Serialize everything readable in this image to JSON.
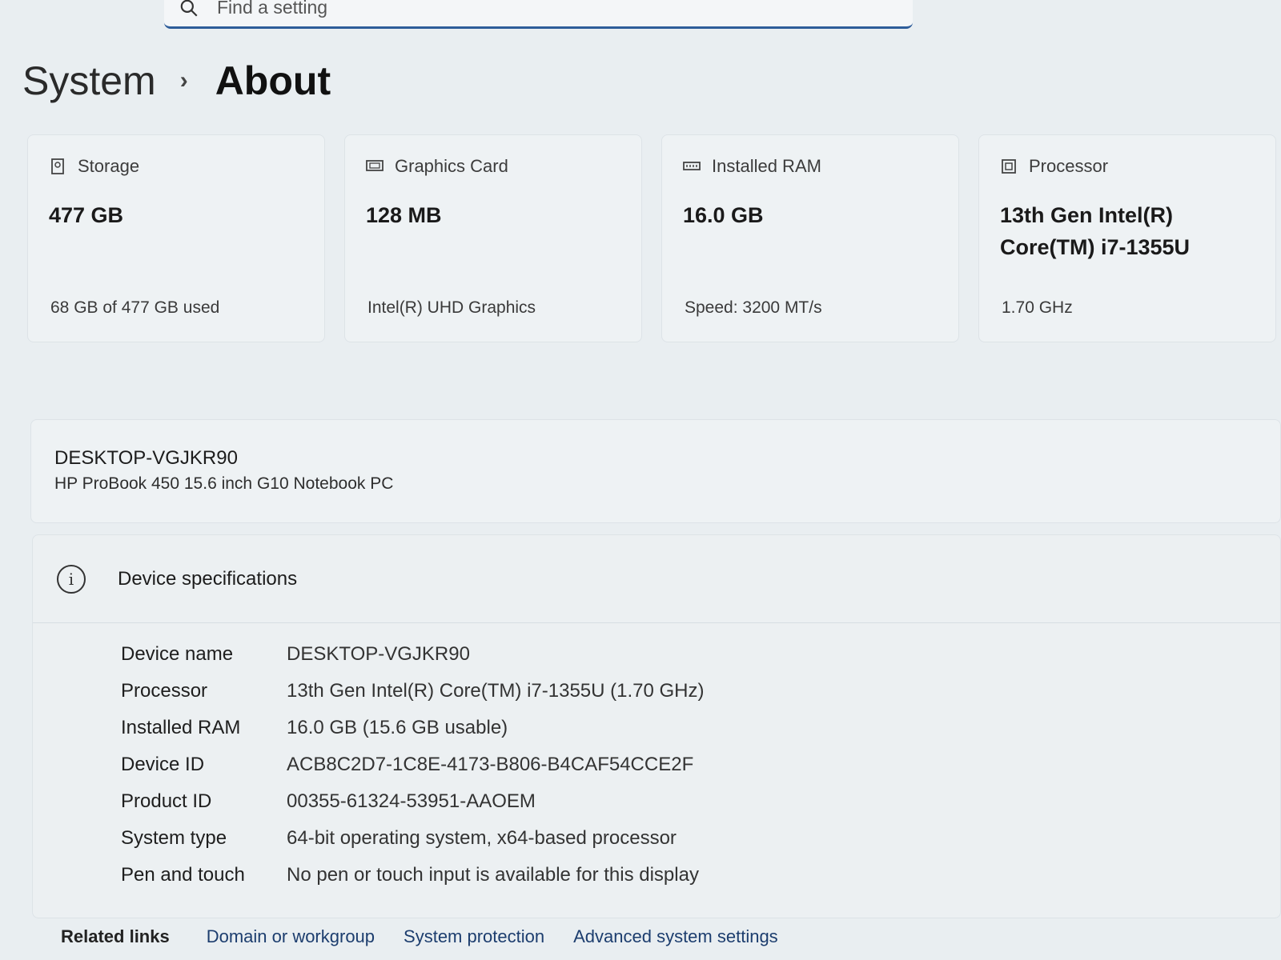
{
  "search": {
    "placeholder": "Find a setting"
  },
  "breadcrumb": {
    "parent": "System",
    "current": "About"
  },
  "cards": [
    {
      "icon": "storage-icon",
      "label": "Storage",
      "value": "477 GB",
      "sub": "68 GB of 477 GB used"
    },
    {
      "icon": "graphics-card-icon",
      "label": "Graphics Card",
      "value": "128 MB",
      "sub": "Intel(R) UHD Graphics"
    },
    {
      "icon": "ram-icon",
      "label": "Installed RAM",
      "value": "16.0 GB",
      "sub": "Speed: 3200 MT/s"
    },
    {
      "icon": "processor-icon",
      "label": "Processor",
      "value": "13th Gen Intel(R) Core(TM) i7-1355U",
      "sub": "1.70 GHz"
    }
  ],
  "device": {
    "name": "DESKTOP-VGJKR90",
    "model": "HP ProBook 450 15.6 inch G10 Notebook PC"
  },
  "specs": {
    "title": "Device specifications",
    "rows": [
      {
        "key": "Device name",
        "value": "DESKTOP-VGJKR90"
      },
      {
        "key": "Processor",
        "value": "13th Gen Intel(R) Core(TM) i7-1355U (1.70 GHz)"
      },
      {
        "key": "Installed RAM",
        "value": "16.0 GB (15.6 GB usable)"
      },
      {
        "key": "Device ID",
        "value": "ACB8C2D7-1C8E-4173-B806-B4CAF54CCE2F"
      },
      {
        "key": "Product ID",
        "value": "00355-61324-53951-AAOEM"
      },
      {
        "key": "System type",
        "value": "64-bit operating system, x64-based processor"
      },
      {
        "key": "Pen and touch",
        "value": "No pen or touch input is available for this display"
      }
    ]
  },
  "related": {
    "label": "Related links",
    "links": [
      "Domain or workgroup",
      "System protection",
      "Advanced system settings"
    ]
  }
}
